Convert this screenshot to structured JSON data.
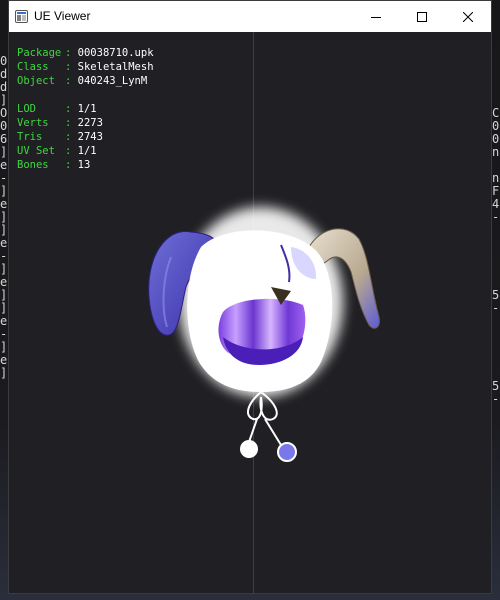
{
  "window": {
    "title": "UE Viewer"
  },
  "icons": {
    "app": "ue-viewer-app-icon",
    "minimize": "minimize-icon",
    "maximize": "maximize-icon",
    "close": "close-icon"
  },
  "colors": {
    "info_label": "#3fd63f",
    "info_value": "#ffffff",
    "axis_line": "#2430d8",
    "viewport_bg": "#202024"
  },
  "mesh_info": {
    "package": {
      "label": "Package",
      "value": "00038710.upk"
    },
    "class": {
      "label": "Class",
      "value": "SkeletalMesh"
    },
    "object": {
      "label": "Object",
      "value": "040243_LynM"
    },
    "lod": {
      "label": "LOD",
      "value": "1/1"
    },
    "verts": {
      "label": "Verts",
      "value": "2273"
    },
    "tris": {
      "label": "Tris",
      "value": "2743"
    },
    "uv_set": {
      "label": "UV Set",
      "value": "1/1"
    },
    "bones": {
      "label": "Bones",
      "value": "13"
    }
  },
  "background_console": {
    "left_chars": [
      "0",
      "d",
      "d",
      "]",
      "O",
      "0",
      "6",
      "]",
      "e",
      "-",
      "]",
      "e",
      "]",
      "]",
      "e",
      "-",
      "]",
      "e",
      "]",
      "]",
      "e",
      "-",
      "]",
      "e",
      "]"
    ],
    "right_chars": [
      "",
      "",
      "",
      "",
      "C",
      "0",
      "0",
      "n",
      "",
      "n",
      "F",
      "4",
      "-",
      "",
      "",
      "",
      "",
      "",
      "5",
      "-",
      "",
      "",
      "",
      "",
      "",
      "5",
      "-"
    ]
  }
}
